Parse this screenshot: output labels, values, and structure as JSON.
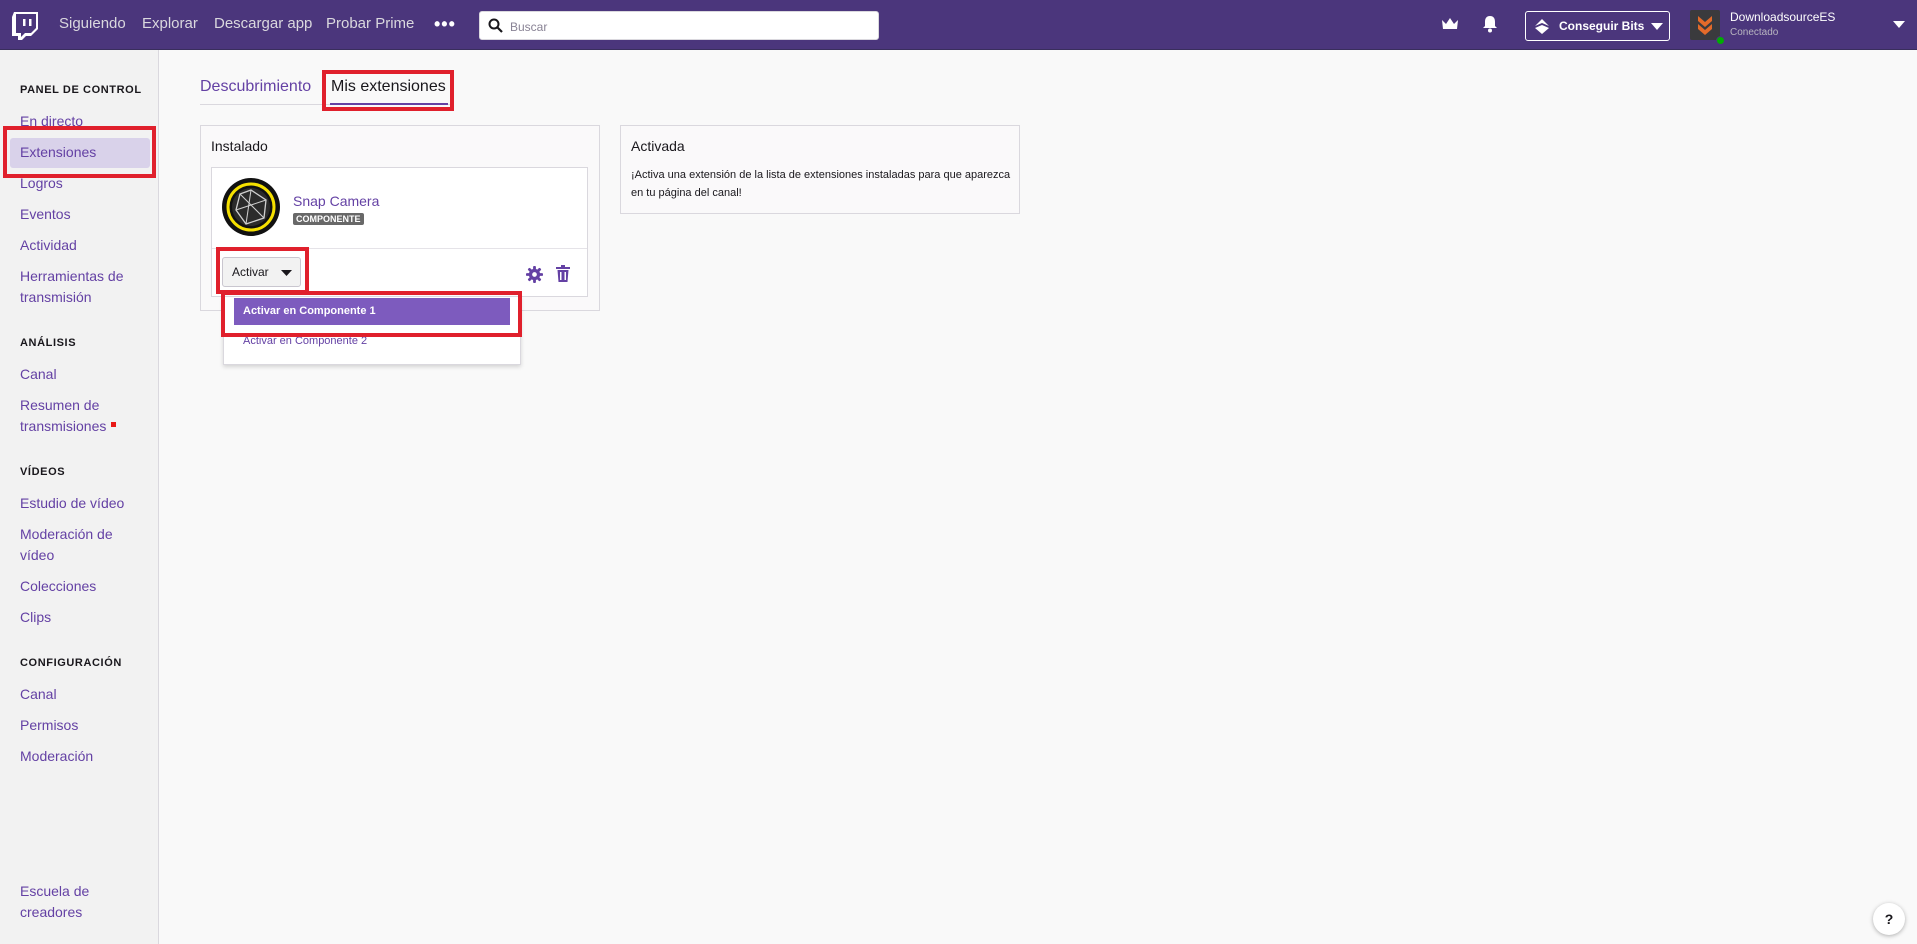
{
  "topnav": {
    "links": [
      "Siguiendo",
      "Explorar",
      "Descargar app",
      "Probar Prime"
    ],
    "more_icon": "more-dots-icon",
    "search_placeholder": "Buscar",
    "bits_label": "Conseguir Bits",
    "username": "DownloadsourceES",
    "user_status": "Conectado"
  },
  "sidebar": {
    "sections": [
      {
        "title": "PANEL DE CONTROL",
        "items": [
          "En directo",
          "Extensiones",
          "Logros",
          "Eventos",
          "Actividad",
          "Herramientas de transmisión"
        ]
      },
      {
        "title": "ANÁLISIS",
        "items": [
          "Canal",
          "Resumen de transmisiones"
        ]
      },
      {
        "title": "VÍDEOS",
        "items": [
          "Estudio de vídeo",
          "Moderación de vídeo",
          "Colecciones",
          "Clips"
        ]
      },
      {
        "title": "CONFIGURACIÓN",
        "items": [
          "Canal",
          "Permisos",
          "Moderación"
        ]
      }
    ],
    "active_item": "Extensiones",
    "footer_link": "Escuela de creadores"
  },
  "tabs": [
    "Descubrimiento",
    "Mis extensiones"
  ],
  "active_tab": "Mis extensiones",
  "installed": {
    "title": "Instalado",
    "extension": {
      "name": "Snap Camera",
      "tag": "COMPONENTE"
    },
    "activate_label": "Activar",
    "dropdown_options": [
      "Activar en Componente 1",
      "Activar en Componente 2"
    ]
  },
  "activated": {
    "title": "Activada",
    "text": "¡Activa una extensión de la lista de extensiones instaladas para que aparezca en tu página del canal!"
  },
  "help_label": "?",
  "colors": {
    "topbar": "#4b367c",
    "accent": "#6441a4",
    "highlight": "#e0202c",
    "dropdown_selected": "#7d5bbe"
  }
}
